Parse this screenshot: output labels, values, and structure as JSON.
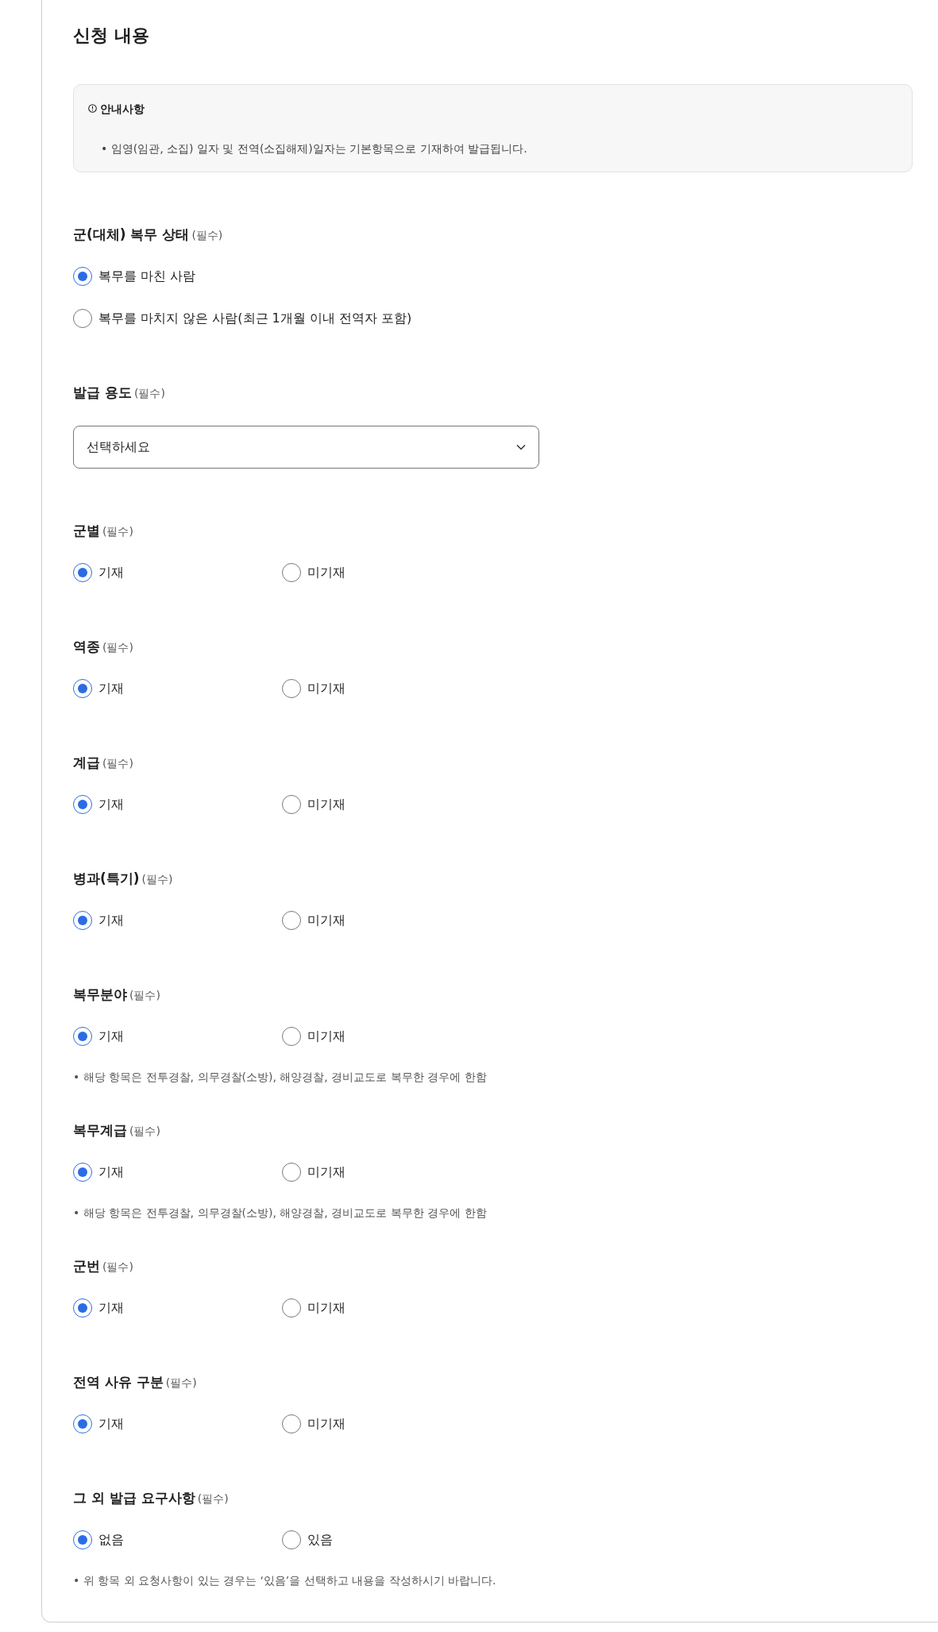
{
  "section_title": "신청 내용",
  "notice": {
    "title": "안내사항",
    "items": [
      "• 임영(임관, 소집) 일자 및 전역(소집해제)일자는 기본항목으로 기재하여 발급됩니다."
    ]
  },
  "fields": [
    {
      "kind": "radio-list",
      "label": "군(대체) 복무 상태",
      "required_mark": "(필수)",
      "options": [
        {
          "label": "복무를 마친 사람",
          "selected": true
        },
        {
          "label": "복무를 마치지 않은 사람(최근 1개월 이내 전역자 포함)",
          "selected": false
        }
      ]
    },
    {
      "kind": "select",
      "label": "발급 용도",
      "required_mark": "(필수)",
      "placeholder": "선택하세요"
    },
    {
      "kind": "radio-row",
      "label": "군별",
      "required_mark": "(필수)",
      "options": [
        {
          "label": "기재",
          "selected": true
        },
        {
          "label": "미기재",
          "selected": false
        }
      ]
    },
    {
      "kind": "radio-row",
      "label": "역종",
      "required_mark": "(필수)",
      "options": [
        {
          "label": "기재",
          "selected": true
        },
        {
          "label": "미기재",
          "selected": false
        }
      ]
    },
    {
      "kind": "radio-row",
      "label": "계급",
      "required_mark": "(필수)",
      "options": [
        {
          "label": "기재",
          "selected": true
        },
        {
          "label": "미기재",
          "selected": false
        }
      ]
    },
    {
      "kind": "radio-row",
      "label": "병과(특기)",
      "required_mark": "(필수)",
      "options": [
        {
          "label": "기재",
          "selected": true
        },
        {
          "label": "미기재",
          "selected": false
        }
      ]
    },
    {
      "kind": "radio-row",
      "label": "복무분야",
      "required_mark": "(필수)",
      "options": [
        {
          "label": "기재",
          "selected": true
        },
        {
          "label": "미기재",
          "selected": false
        }
      ],
      "note": "• 해당 항목은 전투경찰, 의무경찰(소방), 해양경찰, 경비교도로 복무한 경우에 한함"
    },
    {
      "kind": "radio-row",
      "label": "복무계급",
      "required_mark": "(필수)",
      "options": [
        {
          "label": "기재",
          "selected": true
        },
        {
          "label": "미기재",
          "selected": false
        }
      ],
      "note": "• 해당 항목은 전투경찰, 의무경찰(소방), 해양경찰, 경비교도로 복무한 경우에 한함"
    },
    {
      "kind": "radio-row",
      "label": "군번",
      "required_mark": "(필수)",
      "options": [
        {
          "label": "기재",
          "selected": true
        },
        {
          "label": "미기재",
          "selected": false
        }
      ]
    },
    {
      "kind": "radio-row",
      "label": "전역 사유 구분",
      "required_mark": "(필수)",
      "options": [
        {
          "label": "기재",
          "selected": true
        },
        {
          "label": "미기재",
          "selected": false
        }
      ]
    },
    {
      "kind": "radio-row",
      "label": "그 외 발급 요구사항",
      "required_mark": "(필수)",
      "options": [
        {
          "label": "없음",
          "selected": true
        },
        {
          "label": "있음",
          "selected": false
        }
      ],
      "note": "• 위 항목 외 요청사항이 있는 경우는 ‘있음’을 선택하고 내용을 작성하시기 바랍니다."
    }
  ]
}
